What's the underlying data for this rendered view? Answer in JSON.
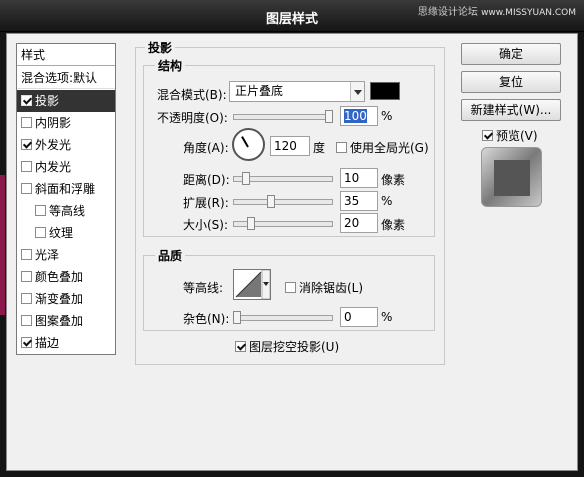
{
  "window": {
    "title": "图层样式",
    "watermark": "思缘设计论坛",
    "watermark_url": "www.MISSYUAN.COM"
  },
  "sidebar": {
    "header": "样式",
    "blend_options": "混合选项:默认",
    "items": [
      {
        "label": "投影",
        "checked": true,
        "selected": true
      },
      {
        "label": "内阴影",
        "checked": false
      },
      {
        "label": "外发光",
        "checked": true
      },
      {
        "label": "内发光",
        "checked": false
      },
      {
        "label": "斜面和浮雕",
        "checked": false
      },
      {
        "label": "等高线",
        "checked": false
      },
      {
        "label": "纹理",
        "checked": false
      },
      {
        "label": "光泽",
        "checked": false
      },
      {
        "label": "颜色叠加",
        "checked": false
      },
      {
        "label": "渐变叠加",
        "checked": false
      },
      {
        "label": "图案叠加",
        "checked": false
      },
      {
        "label": "描边",
        "checked": true
      }
    ]
  },
  "drop_shadow": {
    "title": "投影",
    "structure": {
      "title": "结构",
      "blend_mode_label": "混合模式(B):",
      "blend_mode_value": "正片叠底",
      "shadow_color": "#000000",
      "opacity_label": "不透明度(O):",
      "opacity_value": "100",
      "opacity_unit": "%",
      "angle_label": "角度(A):",
      "angle_value": "120",
      "angle_unit": "度",
      "global_light_label": "使用全局光(G)",
      "global_light_checked": false,
      "distance_label": "距离(D):",
      "distance_value": "10",
      "distance_unit": "像素",
      "spread_label": "扩展(R):",
      "spread_value": "35",
      "spread_unit": "%",
      "size_label": "大小(S):",
      "size_value": "20",
      "size_unit": "像素"
    },
    "quality": {
      "title": "品质",
      "contour_label": "等高线:",
      "anti_alias_label": "消除锯齿(L)",
      "anti_alias_checked": false,
      "noise_label": "杂色(N):",
      "noise_value": "0",
      "noise_unit": "%"
    },
    "knockout_label": "图层挖空投影(U)",
    "knockout_checked": true
  },
  "buttons": {
    "ok": "确定",
    "reset": "复位",
    "new_style": "新建样式(W)...",
    "preview_label": "预览(V)",
    "preview_checked": true
  }
}
